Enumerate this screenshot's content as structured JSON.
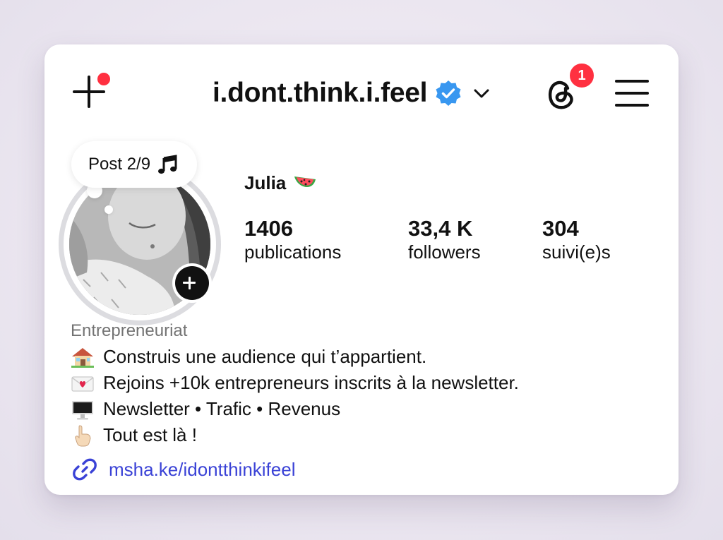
{
  "header": {
    "username": "i.dont.think.i.feel",
    "notification_count": "1",
    "create_icon": "plus-icon",
    "verified_icon": "verified-badge-icon",
    "switch_icon": "chevron-down-icon",
    "threads_icon": "threads-icon",
    "menu_icon": "hamburger-menu-icon"
  },
  "note": {
    "text": "Post 2/9",
    "icon": "music-note-icon"
  },
  "profile": {
    "name": "Julia",
    "name_emoji": "watermelon",
    "stats": [
      {
        "value": "1406",
        "label": "publications"
      },
      {
        "value": "33,4 K",
        "label": "followers"
      },
      {
        "value": "304",
        "label": "suivi(e)s"
      }
    ]
  },
  "bio": {
    "category": "Entrepreneuriat",
    "lines": [
      {
        "icon": "house-icon",
        "text": "Construis une audience qui t’appartient."
      },
      {
        "icon": "love-letter-icon",
        "text": "Rejoins +10k entrepreneurs inscrits à la newsletter."
      },
      {
        "icon": "desktop-computer-icon",
        "text": "Newsletter • Trafic • Revenus"
      },
      {
        "icon": "pointing-down-icon",
        "text": "Tout est là !"
      }
    ],
    "link": "msha.ke/idontthinkifeel",
    "link_icon": "link-icon"
  },
  "colors": {
    "badge_red": "#ff3040",
    "verified_blue": "#3897f0",
    "link_blue": "#3a42d6",
    "category_gray": "#737373"
  }
}
